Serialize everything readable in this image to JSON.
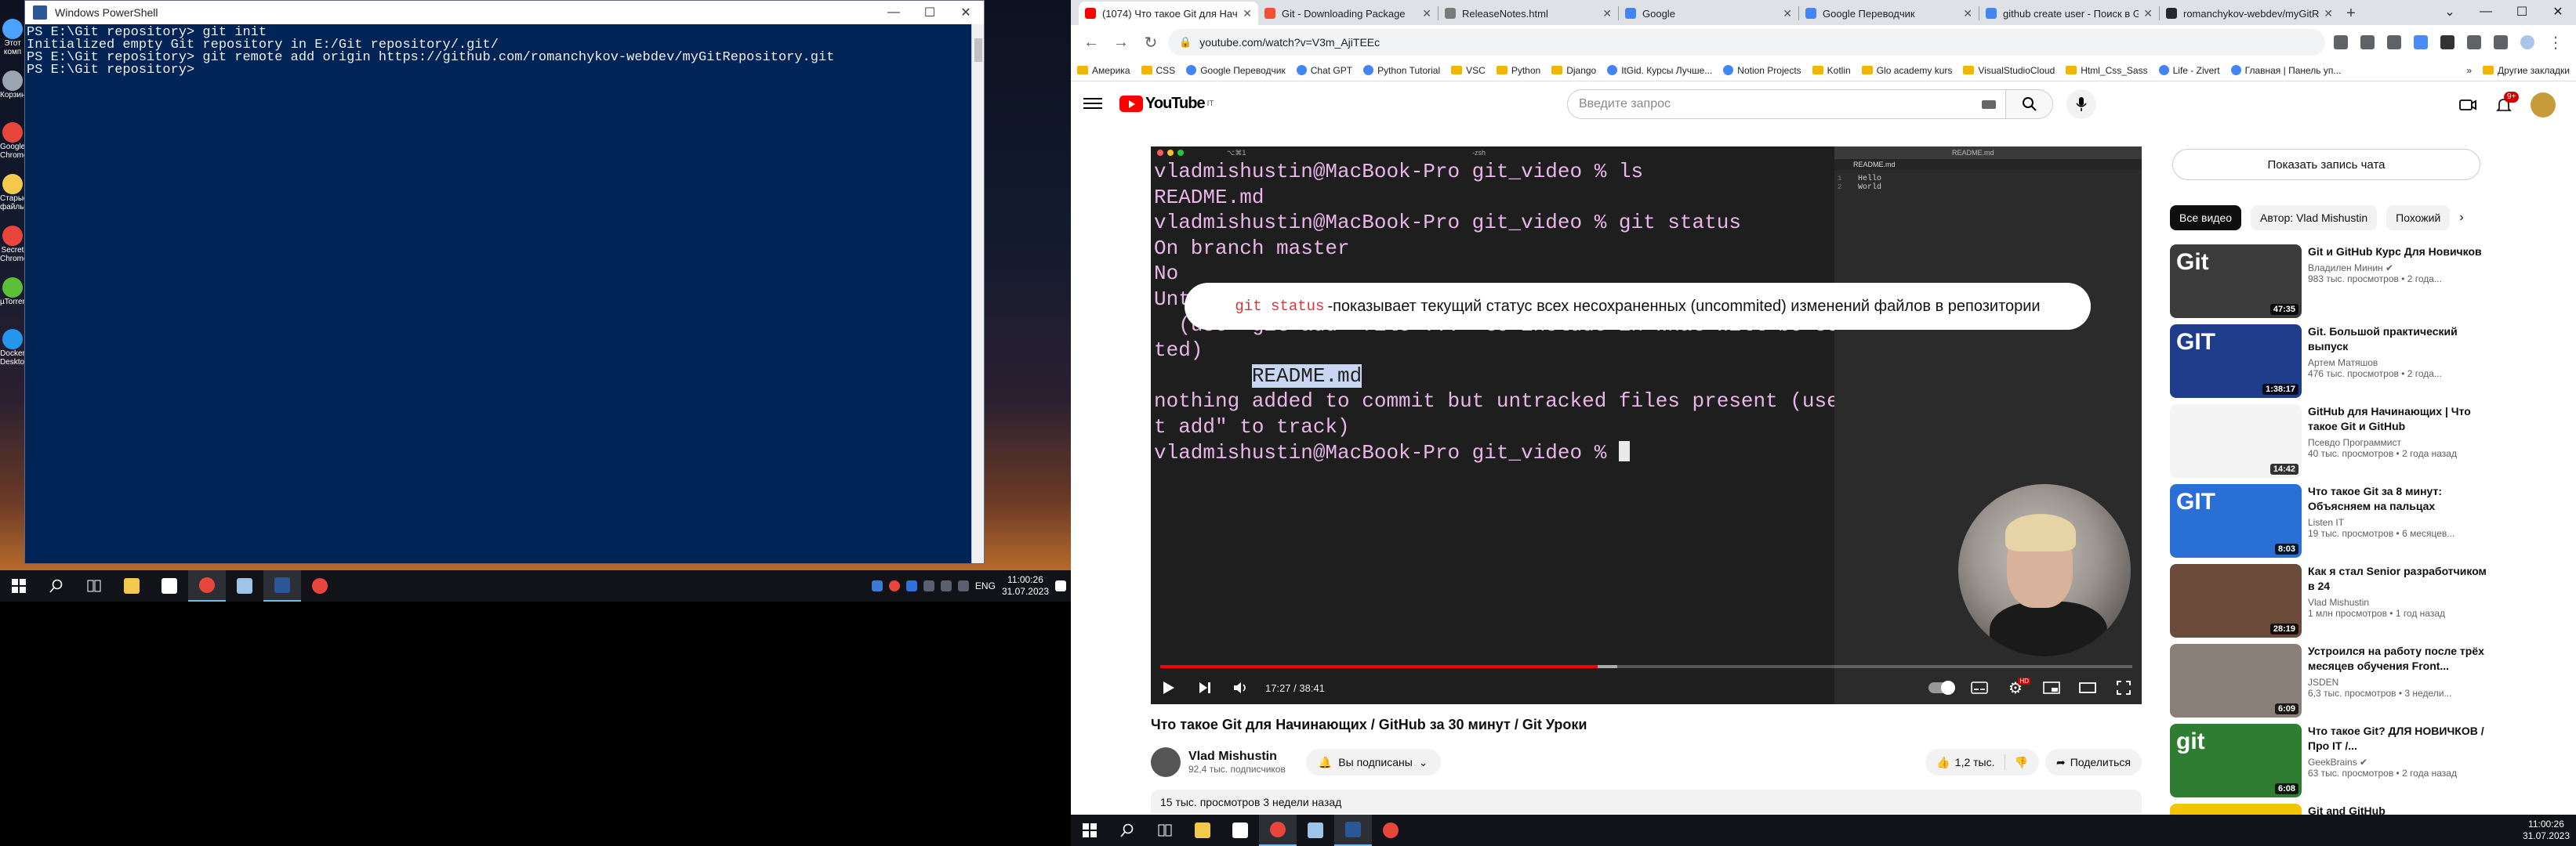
{
  "left": {
    "desktop_icons": [
      {
        "label": "Этот комп",
        "color": "#4aa3ff"
      },
      {
        "label": "Корзина",
        "color": "#9aa5b1"
      },
      {
        "label": "Google Chrome",
        "color": "#e8453c"
      },
      {
        "label": "Старые файлы",
        "color": "#f2c94c"
      },
      {
        "label": "Secret Chrome",
        "color": "#e8453c"
      },
      {
        "label": "µTorrent",
        "color": "#5bbf3a"
      },
      {
        "label": "Docker Desktop",
        "color": "#2496ed"
      }
    ],
    "powershell": {
      "title": "Windows PowerShell",
      "lines": [
        "PS E:\\Git repository> git init",
        "Initialized empty Git repository in E:/Git repository/.git/",
        "PS E:\\Git repository> git remote add origin https://github.com/romanchykov-webdev/myGitRepository.git",
        "PS E:\\Git repository> "
      ]
    },
    "tray": {
      "lang": "ENG",
      "time": "11:00:26",
      "date": "31.07.2023"
    }
  },
  "browser": {
    "tabs": [
      {
        "title": "(1074) Что такое Git для Начи...",
        "color": "#ff0000",
        "active": true
      },
      {
        "title": "Git - Downloading Package",
        "color": "#f05133",
        "active": false
      },
      {
        "title": "ReleaseNotes.html",
        "color": "#7a7a7a",
        "active": false
      },
      {
        "title": "Google",
        "color": "#4285f4",
        "active": false
      },
      {
        "title": "Google Переводчик",
        "color": "#4285f4",
        "active": false
      },
      {
        "title": "github create user - Поиск в G...",
        "color": "#4285f4",
        "active": false
      },
      {
        "title": "romanchykov-webdev/myGitRe...",
        "color": "#24292e",
        "active": false
      }
    ],
    "url": "youtube.com/watch?v=V3m_AjiTEEc",
    "bookmarks": [
      {
        "label": "Америка",
        "type": "folder"
      },
      {
        "label": "CSS",
        "type": "folder"
      },
      {
        "label": "Google Переводчик",
        "type": "site"
      },
      {
        "label": "Chat GPT",
        "type": "site"
      },
      {
        "label": "Python Tutorial",
        "type": "site"
      },
      {
        "label": "VSC",
        "type": "folder"
      },
      {
        "label": "Python",
        "type": "folder"
      },
      {
        "label": "Django",
        "type": "folder"
      },
      {
        "label": "ItGid. Курсы Лучше...",
        "type": "site"
      },
      {
        "label": "Notion Projects",
        "type": "site"
      },
      {
        "label": "Kotlin",
        "type": "folder"
      },
      {
        "label": "Glo academy kurs",
        "type": "folder"
      },
      {
        "label": "VisualStudioCloud",
        "type": "folder"
      },
      {
        "label": "Html_Css_Sass",
        "type": "folder"
      },
      {
        "label": "Life - Zivert",
        "type": "site"
      },
      {
        "label": "Главная | Панель уп...",
        "type": "site"
      }
    ],
    "bookmarks_more": "»",
    "other_bookmarks": "Другие закладки"
  },
  "youtube": {
    "logo": "YouTube",
    "logo_country": "IT",
    "search_placeholder": "Введите запрос",
    "notif_count": "9+",
    "player": {
      "terminal_title": "-zsh",
      "terminal_shortcut": "⌥⌘1",
      "terminal_lines": [
        "vladmishustin@MacBook-Pro git_video % ls",
        "README.md",
        "vladmishustin@MacBook-Pro git_video % git status",
        "On branch master",
        "",
        "No",
        "",
        "Untracked files:",
        "  (use \"git add <file>...\" to include in what will be commit",
        "ted)",
        "        README.md",
        "",
        "nothing added to commit but untracked files present (use \"gi",
        "t add\" to track)",
        "vladmishustin@MacBook-Pro git_video % "
      ],
      "editor_title": "README.md",
      "editor_tab": "README.md",
      "editor_lines": [
        "Hello",
        "World"
      ],
      "editor_gutter": [
        "1",
        "2"
      ],
      "caption_code": "git status",
      "caption_text": "-показывает текущий статус всех несохраненных (uncommited) изменений файлов в репозитории",
      "time": "17:27 / 38:41",
      "progress_played": 0.45,
      "progress_loaded": 0.47
    },
    "video_title": "Что такое Git для Начинающих / GitHub за 30 минут / Git Уроки",
    "channel": {
      "name": "Vlad Mishustin",
      "subs": "92,4 тыс. подписчиков"
    },
    "subscribed_label": "Вы подписаны",
    "likes": "1,2 тыс.",
    "share_label": "Поделиться",
    "description_meta": "15 тыс. просмотров  3 недели назад",
    "chat_button": "Показать запись чата",
    "chips": [
      "Все видео",
      "Автор: Vlad Mishustin",
      "Похожий"
    ],
    "recommendations": [
      {
        "title": "Git и GitHub Курс Для Новичков",
        "channel": "Владилен Минин ✔",
        "meta": "983 тыс. просмотров • 2 года...",
        "duration": "47:35",
        "thumb_text": "Git",
        "thumb_color": "#3b3b3b"
      },
      {
        "title": "Git. Большой практический выпуск",
        "channel": "Артем Матяшов",
        "meta": "476 тыс. просмотров • 2 года...",
        "duration": "1:38:17",
        "thumb_text": "GIT",
        "thumb_color": "#1f3d8a"
      },
      {
        "title": "GitHub для Начинающих | Что такое Git и GitHub",
        "channel": "Псевдо Программист",
        "meta": "40 тыс. просмотров • 2 года назад",
        "duration": "14:42",
        "thumb_text": "",
        "thumb_color": "#f4f4f4"
      },
      {
        "title": "Что такое Git за 8 минут: Объясняем на пальцах",
        "channel": "Listen IT",
        "meta": "19 тыс. просмотров • 6 месяцев...",
        "duration": "8:03",
        "thumb_text": "GIT",
        "thumb_color": "#2a6fd6"
      },
      {
        "title": "Как я стал Senior разработчиком в 24",
        "channel": "Vlad Mishustin",
        "meta": "1 млн просмотров • 1 год назад",
        "duration": "28:19",
        "thumb_text": "",
        "thumb_color": "#6b4a3a"
      },
      {
        "title": "Устроился на работу после трёх месяцев обучения Front...",
        "channel": "JSDEN",
        "meta": "6,3 тыс. просмотров • 3 недели...",
        "duration": "6:09",
        "thumb_text": "",
        "thumb_color": "#8a7f78"
      },
      {
        "title": "Что такое Git? ДЛЯ НОВИЧКОВ / Про IT /...",
        "channel": "GeekBrains ✔",
        "meta": "63 тыс. просмотров • 2 года назад",
        "duration": "6:08",
        "thumb_text": "git",
        "thumb_color": "#2e7d32"
      },
      {
        "title": "Git and GitHub",
        "channel": "",
        "meta": "",
        "duration": "",
        "thumb_text": "",
        "thumb_color": "#f5c400"
      }
    ]
  },
  "right_tray": {
    "time": "11:00:26",
    "date": "31.07.2023"
  },
  "colors": {
    "ps_bg": "#012456",
    "yt_red": "#ff0000",
    "terminal_text": "#e9b6e9"
  }
}
